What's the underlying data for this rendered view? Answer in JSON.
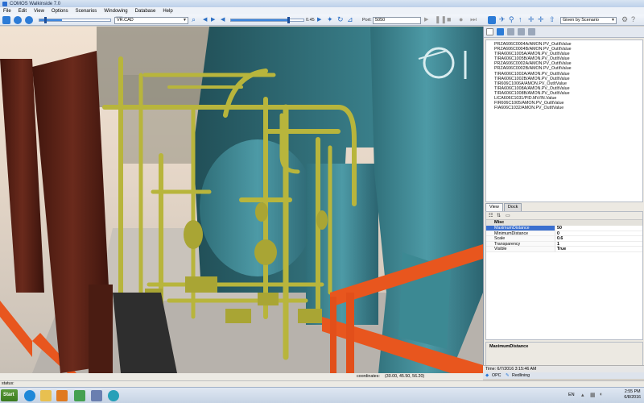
{
  "window": {
    "title": "COMOS Walkinside 7.0"
  },
  "menu": [
    "File",
    "Edit",
    "View",
    "Options",
    "Scenarios",
    "Windowing",
    "Database",
    "Help"
  ],
  "toolbar": {
    "model_combo": "VR.CAD",
    "speed_value": "0.45",
    "port_label": "Port:",
    "port_value": "5050",
    "scenario_combo": "Given by Scenario",
    "speed_slider_fraction": 0.8
  },
  "signals": [
    "PRZA606C0004A/AMON.PV_OutItValue",
    "PRZA606C0004B/AMON.PV_OutItValue",
    "TIRA606C1005A/AMON.PV_OutItValue",
    "TIRA606C1005B/AMON.PV_OutItValue",
    "PRZA606C0002A/AMON.PV_OutItValue",
    "PRZA606C0002B/AMON.PV_OutItValue",
    "TIRA606C1002A/AMON.PV_OutItValue",
    "TIRA606C1002B/AMON.PV_OutItValue",
    "TIR606C1006A/AMON.PV_OutItValue",
    "TIRA606C1008A/AMON.PV_OutItValue",
    "TIRA606C1008B/AMON.PV_OutItValue",
    "LICA606C1031/PID.MV/IN.Value",
    "FIR606C1005/AMON.PV_OutItValue",
    "FIA606C1032/AMON.PV_OutItValue"
  ],
  "panel_tabs": [
    "View",
    "Dock"
  ],
  "properties": {
    "category": "Misc",
    "rows": [
      {
        "name": "MaximumDistance",
        "value": "50"
      },
      {
        "name": "MinimumDistance",
        "value": "0"
      },
      {
        "name": "Scale",
        "value": "0.6"
      },
      {
        "name": "Transparency",
        "value": "1"
      },
      {
        "name": "Visible",
        "value": "True"
      }
    ],
    "description_title": "MaximumDistance"
  },
  "time_text": "Time: 6/7/2016 3:15:46 AM",
  "bottom_tabs": {
    "opc": "OPC",
    "redlining": "Redlining"
  },
  "coordinates_label": "coordinates:",
  "coordinates_value": "(30.00, 45.50, 56.20)",
  "status_text": "status:",
  "taskbar": {
    "start_label": "Start",
    "lang": "EN",
    "time": "2:55 PM",
    "date": "6/8/2016"
  },
  "colors": {
    "pipe_yellow": "#b8b53c",
    "vessel_teal": "#3f8a96",
    "beam_orange": "#e8561e",
    "column_brown": "#5a2418",
    "accent_blue": "#2c7bd6"
  }
}
